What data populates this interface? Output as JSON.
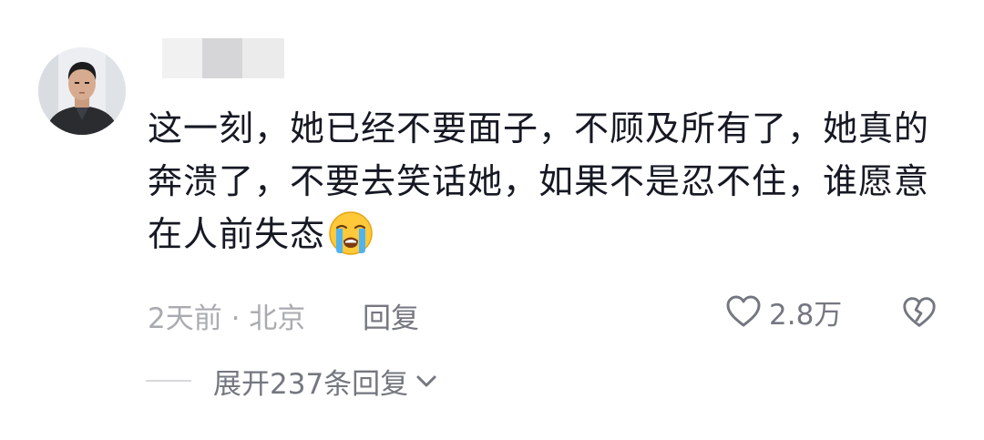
{
  "comment": {
    "text_lines": [
      "这一刻，她已经不要面子，不顾及所有了，她真的",
      "奔溃了，不要去笑话她，如果不是忍不住，谁愿意",
      "在人前失态"
    ],
    "emoji_icon": "loudly-crying-face-emoji",
    "time_location": "2天前 · 北京",
    "reply_label": "回复",
    "like_count": "2.8万",
    "expand_replies_label": "展开237条回复"
  },
  "colors": {
    "primary_text": "#161823",
    "secondary_text": "#757780",
    "muted_text": "#a9abb0",
    "divider": "#d8d9dc"
  },
  "icons": {
    "like": "heart-outline-icon",
    "dislike": "broken-heart-icon",
    "expand": "chevron-down-icon"
  }
}
